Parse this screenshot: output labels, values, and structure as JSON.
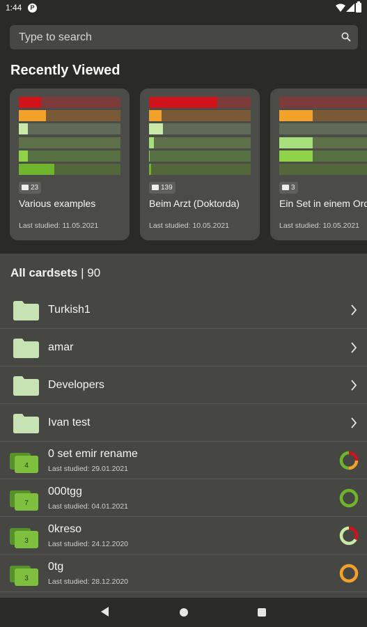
{
  "status": {
    "time": "1:44",
    "app_icon": "P"
  },
  "search": {
    "placeholder": "Type to search"
  },
  "recent": {
    "title": "Recently Viewed",
    "cards": [
      {
        "name": "Various examples",
        "count": "23",
        "last_studied": "Last studied: 11.05.2021",
        "levels": [
          0.22,
          0.27,
          0.09,
          0.0,
          0.09,
          0.35
        ]
      },
      {
        "name": "Beim Arzt (Doktorda)",
        "count": "139",
        "last_studied": "Last studied: 10.05.2021",
        "levels": [
          0.67,
          0.12,
          0.14,
          0.05,
          0.01,
          0.02
        ]
      },
      {
        "name": "Ein Set in einem Ordner",
        "count": "3",
        "last_studied": "Last studied: 10.05.2021",
        "levels": [
          0.0,
          0.33,
          0.0,
          0.33,
          0.33,
          0.0
        ]
      }
    ]
  },
  "all_cardsets": {
    "label": "All cardsets",
    "count": "90"
  },
  "folders": [
    {
      "name": "Turkish1"
    },
    {
      "name": "amar"
    },
    {
      "name": "Developers"
    },
    {
      "name": "Ivan test"
    }
  ],
  "sets": [
    {
      "name": "0 set emir rename",
      "count": "4",
      "last_studied": "Last studied: 29.01.2021",
      "ring": [
        {
          "color": "#d0121b",
          "frac": 0.25
        },
        {
          "color": "#f2a22a",
          "frac": 0.25
        },
        {
          "color": "#6fb52c",
          "frac": 0.5
        }
      ]
    },
    {
      "name": "000tgg",
      "count": "7",
      "last_studied": "Last studied: 04.01.2021",
      "ring": [
        {
          "color": "#6fb52c",
          "frac": 1.0
        }
      ]
    },
    {
      "name": "0kreso",
      "count": "3",
      "last_studied": "Last studied: 24.12.2020",
      "ring": [
        {
          "color": "#d0121b",
          "frac": 0.33
        },
        {
          "color": "#c8eaa6",
          "frac": 0.67
        }
      ]
    },
    {
      "name": "0tg",
      "count": "3",
      "last_studied": "Last studied: 28.12.2020",
      "ring": [
        {
          "color": "#f2a22a",
          "frac": 1.0
        }
      ]
    }
  ],
  "colors": {
    "level_fill": [
      "#d0121b",
      "#f2a22a",
      "#c8eaa6",
      "#a6e07a",
      "#8dd247",
      "#6fb52c"
    ],
    "level_bg": [
      "#7d3a3a",
      "#7a5a36",
      "#5f6b57",
      "#5e7049",
      "#577043",
      "#53673b"
    ]
  }
}
